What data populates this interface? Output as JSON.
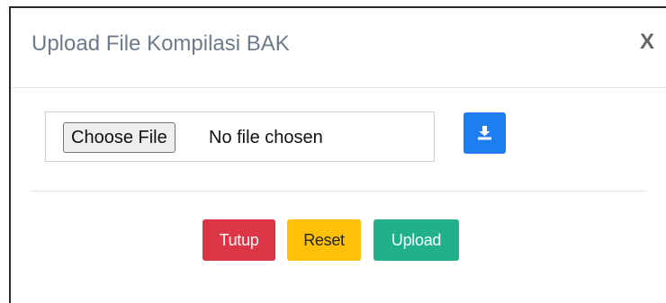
{
  "modal": {
    "title": "Upload File Kompilasi BAK",
    "close_label": "X"
  },
  "file_input": {
    "button_label": "Choose File",
    "status_text": "No file chosen"
  },
  "download_button": {
    "icon": "download-icon",
    "color": "#1e7ef0"
  },
  "actions": {
    "tutup_label": "Tutup",
    "reset_label": "Reset",
    "upload_label": "Upload"
  },
  "colors": {
    "danger": "#dc3545",
    "warning": "#ffc107",
    "success": "#20b08a",
    "primary": "#1e7ef0"
  }
}
